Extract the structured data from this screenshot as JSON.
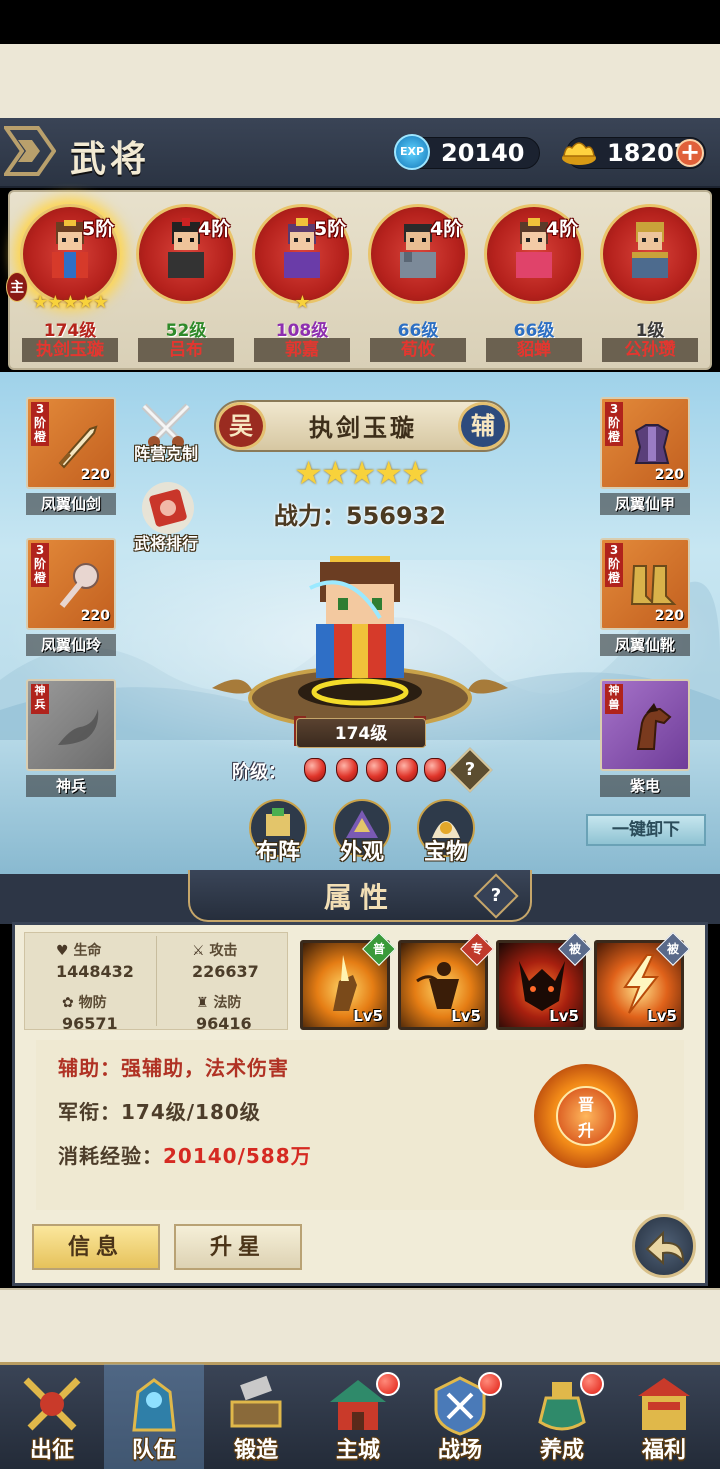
{
  "header": {
    "title": "武将",
    "exp_icon_label": "EXP",
    "exp_value": "20140",
    "gold_value": "18207",
    "plus": "+"
  },
  "heroes": [
    {
      "tier": "5阶",
      "stars": "★★★★★",
      "level": "174级",
      "name": "执剑玉璇",
      "level_color": "#b5241c",
      "main": "主"
    },
    {
      "tier": "4阶",
      "stars": "",
      "level": "52级",
      "name": "吕布",
      "level_color": "#2f8a2a"
    },
    {
      "tier": "5阶",
      "stars": "★",
      "level": "108级",
      "name": "郭嘉",
      "level_color": "#8e2fb0"
    },
    {
      "tier": "4阶",
      "stars": "",
      "level": "66级",
      "name": "荀攸",
      "level_color": "#2c6fc4"
    },
    {
      "tier": "4阶",
      "stars": "",
      "level": "66级",
      "name": "貂蝉",
      "level_color": "#2c6fc4"
    },
    {
      "tier": "",
      "stars": "",
      "level": "1级",
      "name": "公孙瓒",
      "level_color": "#3a3a3a"
    }
  ],
  "equipment": {
    "left": [
      {
        "rank": "3阶橙",
        "value": "220",
        "label": "凤翼仙剑"
      },
      {
        "rank": "3阶橙",
        "value": "220",
        "label": "凤翼仙玲"
      },
      {
        "rank": "神兵",
        "value": "",
        "label": "神兵"
      }
    ],
    "right": [
      {
        "rank": "3阶橙",
        "value": "220",
        "label": "凤翼仙甲"
      },
      {
        "rank": "3阶橙",
        "value": "220",
        "label": "凤翼仙靴"
      },
      {
        "rank": "神兽",
        "value": "",
        "label": "紫电"
      }
    ]
  },
  "side_buttons": {
    "counter": "阵营克制",
    "ranking": "武将排行"
  },
  "selected": {
    "camp": "吴",
    "role": "辅",
    "name": "执剑玉璇",
    "stars": "★★★★★",
    "power": "战力：556932",
    "level": "174级",
    "rank_label": "阶级：",
    "rank_gems": 5,
    "help": "?"
  },
  "actions": {
    "formation": "布阵",
    "appearance": "外观",
    "treasure": "宝物",
    "unequip_all": "一键卸下"
  },
  "attributes": {
    "title": "属性",
    "help": "?",
    "hp_label": "生命",
    "hp": "1448432",
    "atk_label": "攻击",
    "atk": "226637",
    "pdef_label": "物防",
    "pdef": "96571",
    "mdef_label": "法防",
    "mdef": "96416"
  },
  "skills": [
    {
      "tag": "普",
      "tag_color": "#3a9a3a",
      "level": "Lv5"
    },
    {
      "tag": "专",
      "tag_color": "#c0392b",
      "level": "Lv5"
    },
    {
      "tag": "被",
      "tag_color": "#5a6a8a",
      "level": "Lv5"
    },
    {
      "tag": "被",
      "tag_color": "#5a6a8a",
      "level": "Lv5"
    }
  ],
  "info": {
    "role_line": "辅助：强辅助，法术伤害",
    "rank_line": "军衔：174级/180级",
    "cost_label": "消耗经验：",
    "cost_value": "20140/588万",
    "promote": "晋升"
  },
  "tabs": {
    "info": "信息",
    "upstar": "升星"
  },
  "nav": [
    {
      "label": "出征",
      "dot": false
    },
    {
      "label": "队伍",
      "dot": false,
      "active": true
    },
    {
      "label": "锻造",
      "dot": false
    },
    {
      "label": "主城",
      "dot": true
    },
    {
      "label": "战场",
      "dot": true
    },
    {
      "label": "养成",
      "dot": true
    },
    {
      "label": "福利",
      "dot": false
    }
  ]
}
